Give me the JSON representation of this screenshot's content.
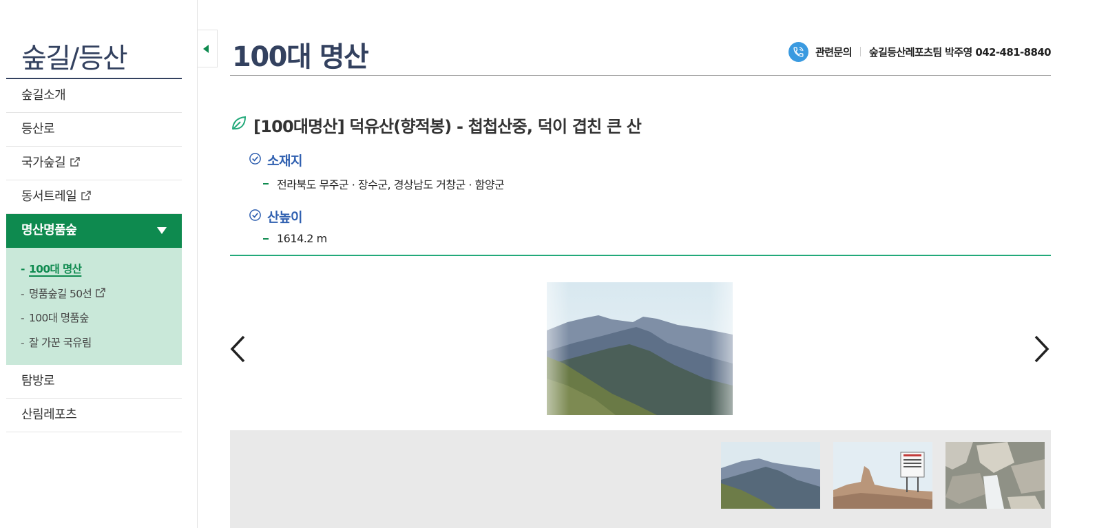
{
  "sidebar": {
    "title": "숲길/등산",
    "items": [
      {
        "label": "숲길소개",
        "external": false
      },
      {
        "label": "등산로",
        "external": false
      },
      {
        "label": "국가숲길",
        "external": true
      },
      {
        "label": "동서트레일",
        "external": true
      },
      {
        "label": "명산명품숲",
        "external": false,
        "expanded": true
      },
      {
        "label": "탐방로",
        "external": false
      },
      {
        "label": "산림레포츠",
        "external": false
      }
    ],
    "submenu": [
      {
        "label": "100대 명산",
        "current": true
      },
      {
        "label": "명품숲길 50선",
        "external": true
      },
      {
        "label": "100대 명품숲"
      },
      {
        "label": "잘 가꾼 국유림"
      }
    ]
  },
  "header": {
    "page_title": "100대 명산",
    "contact_label": "관련문의",
    "contact_info": "숲길등산레포츠팀 박주영 042-481-8840"
  },
  "mountain": {
    "title": "[100대명산] 덕유산(향적봉) - 첩첩산중, 덕이 겹친 큰 산",
    "location_label": "소재지",
    "location_value": "전라북도 무주군 · 장수군, 경상남도 거창군 · 함양군",
    "height_label": "산높이",
    "height_value": "1614.2 m"
  },
  "gallery": {
    "thumbnail_count": 3
  },
  "colors": {
    "primary_green": "#0e8a4f",
    "submenu_bg": "#c9e8d9",
    "title_navy": "#33415f",
    "label_blue": "#3060b0",
    "phone_blue": "#3a9ae0",
    "divider_green": "#22a97a"
  },
  "icons": [
    "phone-icon",
    "leaf-icon",
    "check-circle-icon",
    "external-link-icon",
    "caret-down-icon",
    "chevron-left-icon",
    "chevron-right-icon",
    "collapse-icon"
  ]
}
